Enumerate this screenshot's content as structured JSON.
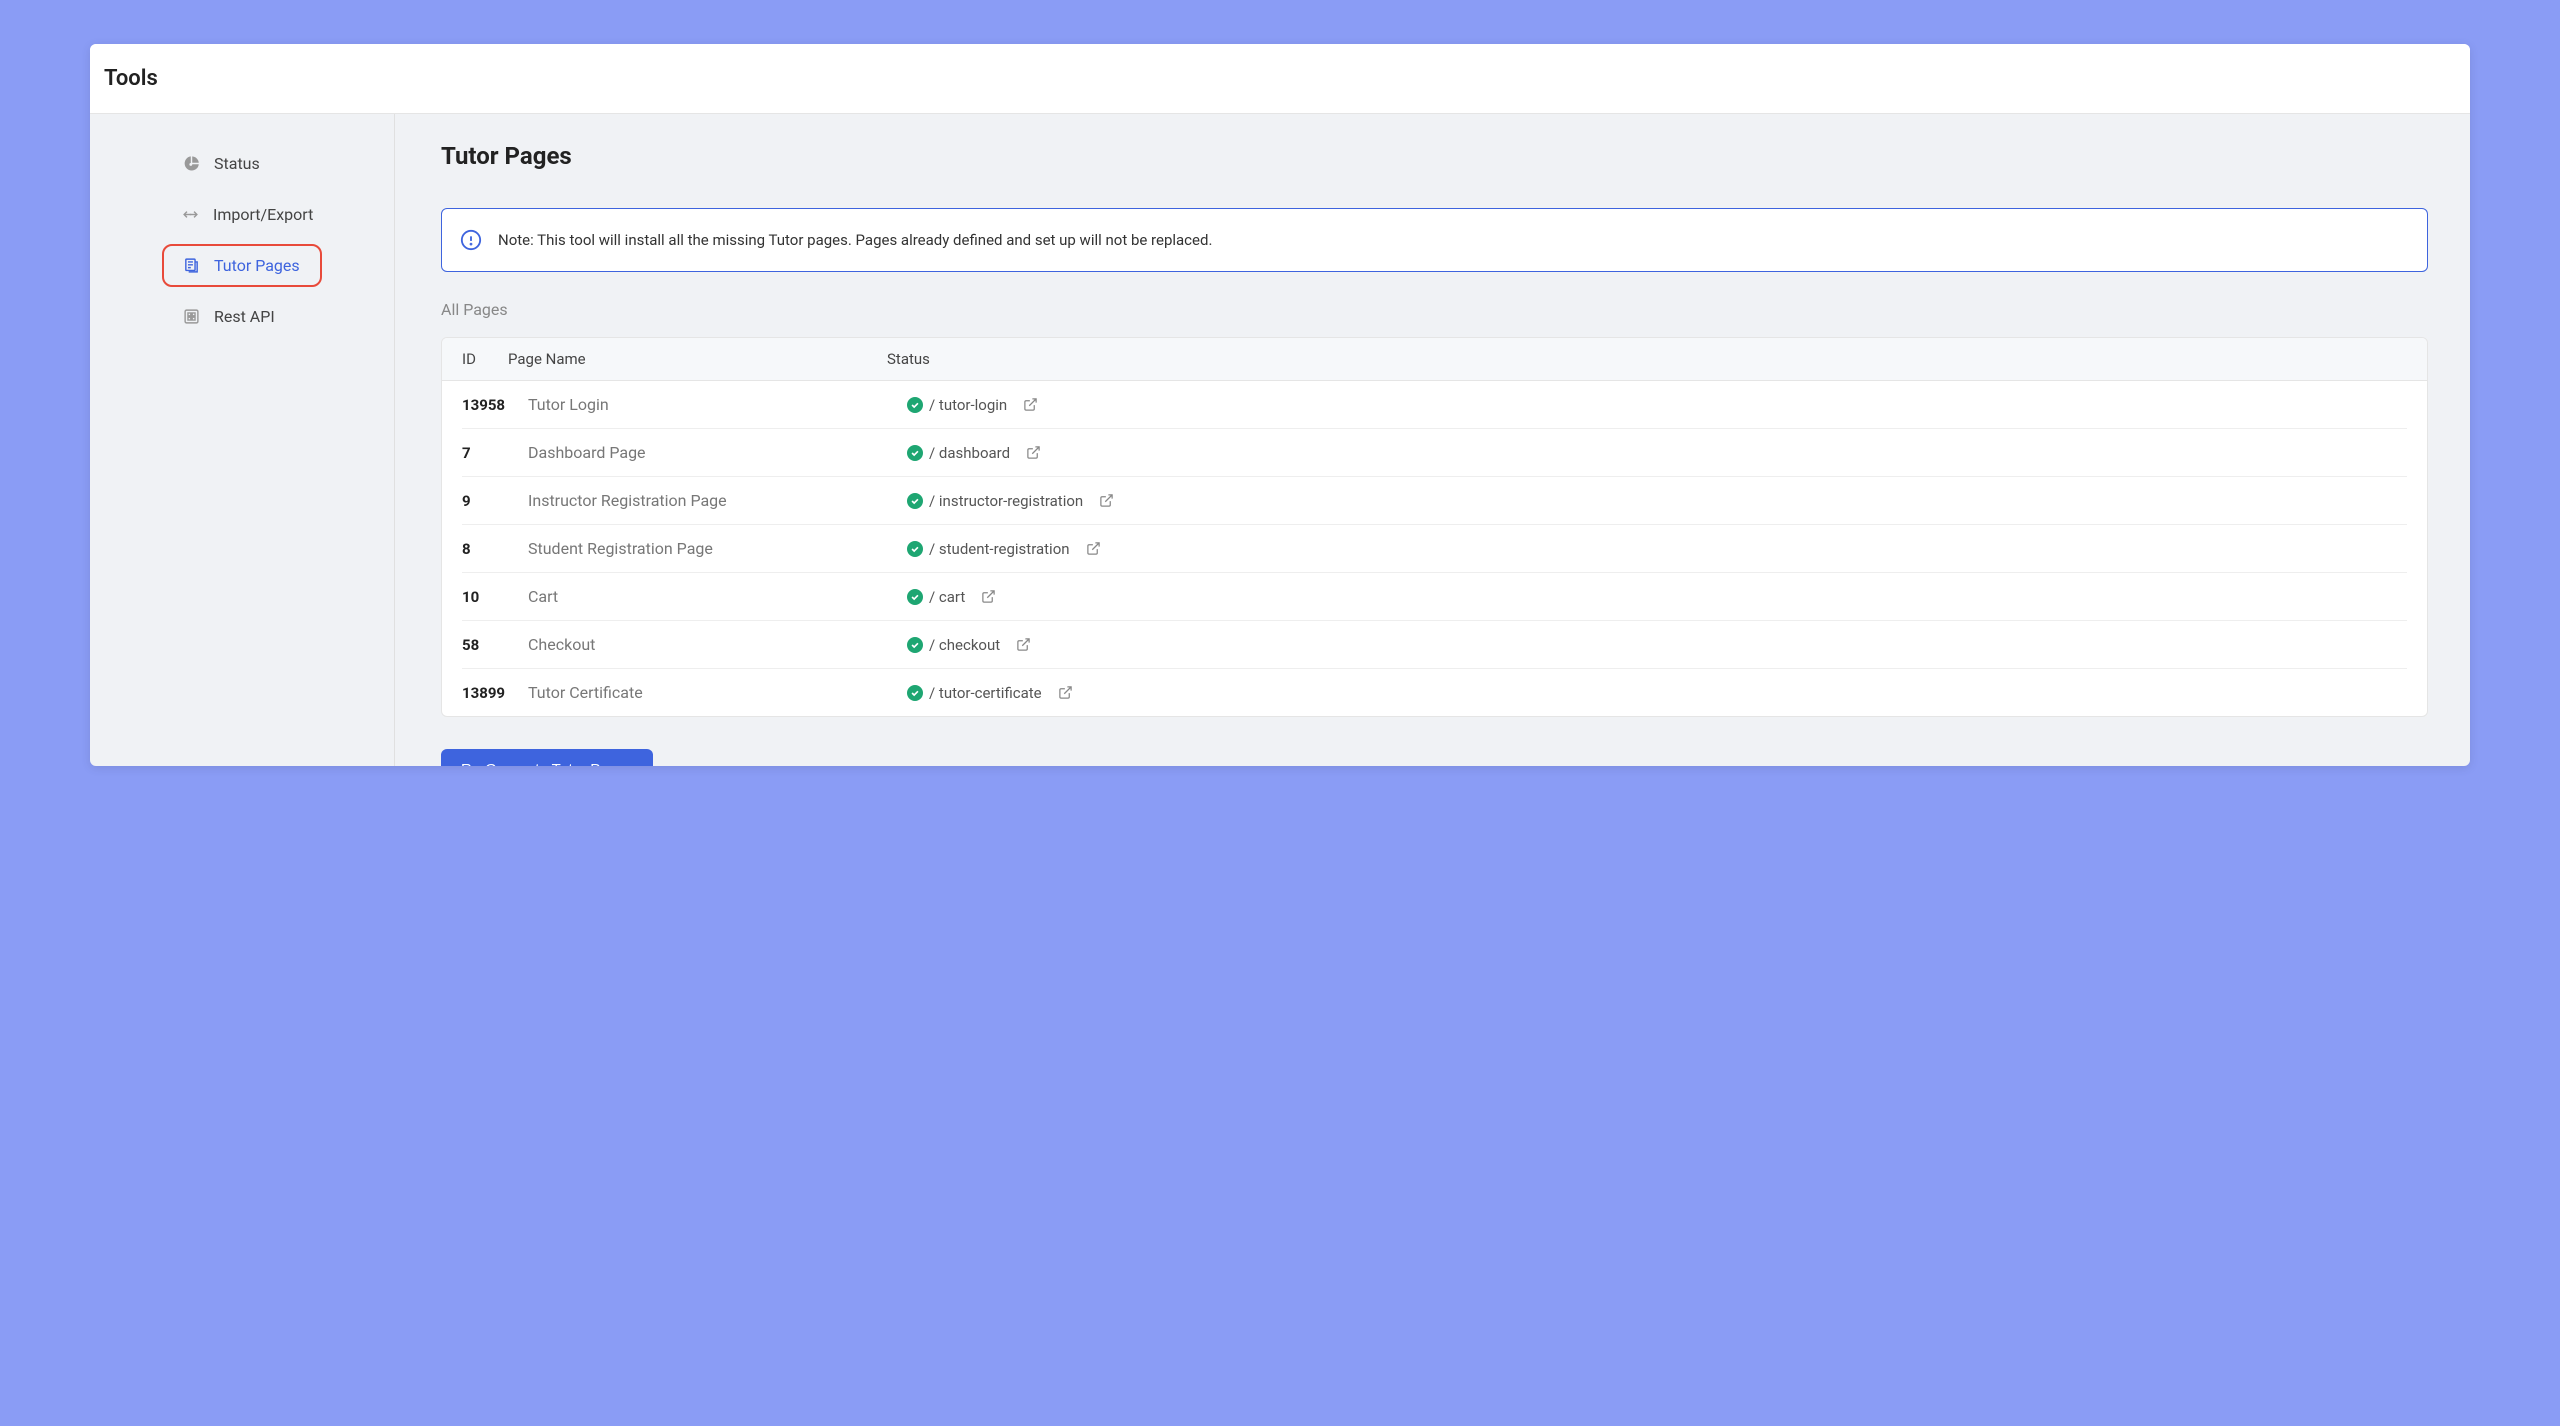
{
  "header": {
    "title": "Tools"
  },
  "sidebar": {
    "items": [
      {
        "label": "Status"
      },
      {
        "label": "Import/Export"
      },
      {
        "label": "Tutor Pages"
      },
      {
        "label": "Rest API"
      }
    ]
  },
  "content": {
    "title": "Tutor Pages",
    "info_note": "Note: This tool will install all the missing Tutor pages. Pages already defined and set up will not be replaced.",
    "section_label": "All Pages",
    "table_headers": {
      "id": "ID",
      "page_name": "Page Name",
      "status": "Status"
    },
    "pages": [
      {
        "id": "13958",
        "name": "Tutor Login",
        "slug": "/ tutor-login"
      },
      {
        "id": "7",
        "name": "Dashboard Page",
        "slug": "/ dashboard"
      },
      {
        "id": "9",
        "name": "Instructor Registration Page",
        "slug": "/ instructor-registration"
      },
      {
        "id": "8",
        "name": "Student Registration Page",
        "slug": "/ student-registration"
      },
      {
        "id": "10",
        "name": "Cart",
        "slug": "/ cart"
      },
      {
        "id": "58",
        "name": "Checkout",
        "slug": "/ checkout"
      },
      {
        "id": "13899",
        "name": "Tutor Certificate",
        "slug": "/ tutor-certificate"
      }
    ],
    "regenerate_button": "Re-Generate Tutor Pages"
  }
}
